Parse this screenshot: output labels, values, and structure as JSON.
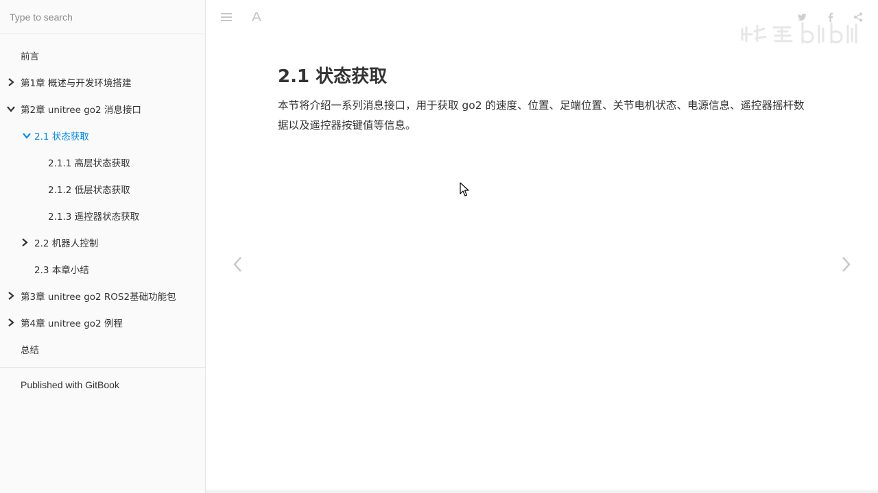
{
  "search": {
    "placeholder": "Type to search"
  },
  "sidebar": {
    "items": [
      {
        "label": "前言",
        "level": 1,
        "expander": "none",
        "active": false
      },
      {
        "label": "第1章 概述与开发环境搭建",
        "level": 1,
        "expander": "collapsed",
        "active": false
      },
      {
        "label": "第2章 unitree go2 消息接口",
        "level": 1,
        "expander": "expanded",
        "active": false
      },
      {
        "label": "2.1 状态获取",
        "level": 2,
        "expander": "expanded",
        "active": true
      },
      {
        "label": "2.1.1 高层状态获取",
        "level": 3,
        "expander": "none",
        "active": false
      },
      {
        "label": "2.1.2 低层状态获取",
        "level": 3,
        "expander": "none",
        "active": false
      },
      {
        "label": "2.1.3 遥控器状态获取",
        "level": 3,
        "expander": "none",
        "active": false
      },
      {
        "label": "2.2 机器人控制",
        "level": 2,
        "expander": "collapsed",
        "active": false
      },
      {
        "label": "2.3 本章小结",
        "level": 2,
        "expander": "none",
        "active": false
      },
      {
        "label": "第3章 unitree go2 ROS2基础功能包",
        "level": 1,
        "expander": "collapsed",
        "active": false
      },
      {
        "label": "第4章 unitree go2 例程",
        "level": 1,
        "expander": "collapsed",
        "active": false
      },
      {
        "label": "总结",
        "level": 1,
        "expander": "none",
        "active": false
      }
    ],
    "published": "Published with GitBook"
  },
  "toolbar": {
    "menu_icon": "hamburger-icon",
    "font_icon": "font-settings-icon",
    "share_icons": [
      "twitter-icon",
      "facebook-icon",
      "share-icon"
    ]
  },
  "main": {
    "title": "2.1 状态获取",
    "body": "本节将介绍一系列消息接口，用于获取 go2 的速度、位置、足端位置、关节电机状态、电源信息、遥控器摇杆数据以及遥控器按键值等信息。"
  },
  "colors": {
    "active": "#008cff",
    "text": "#333333",
    "sidebar_bg": "#fafafa",
    "border": "#e6e6e6",
    "icon": "#cccccc"
  }
}
